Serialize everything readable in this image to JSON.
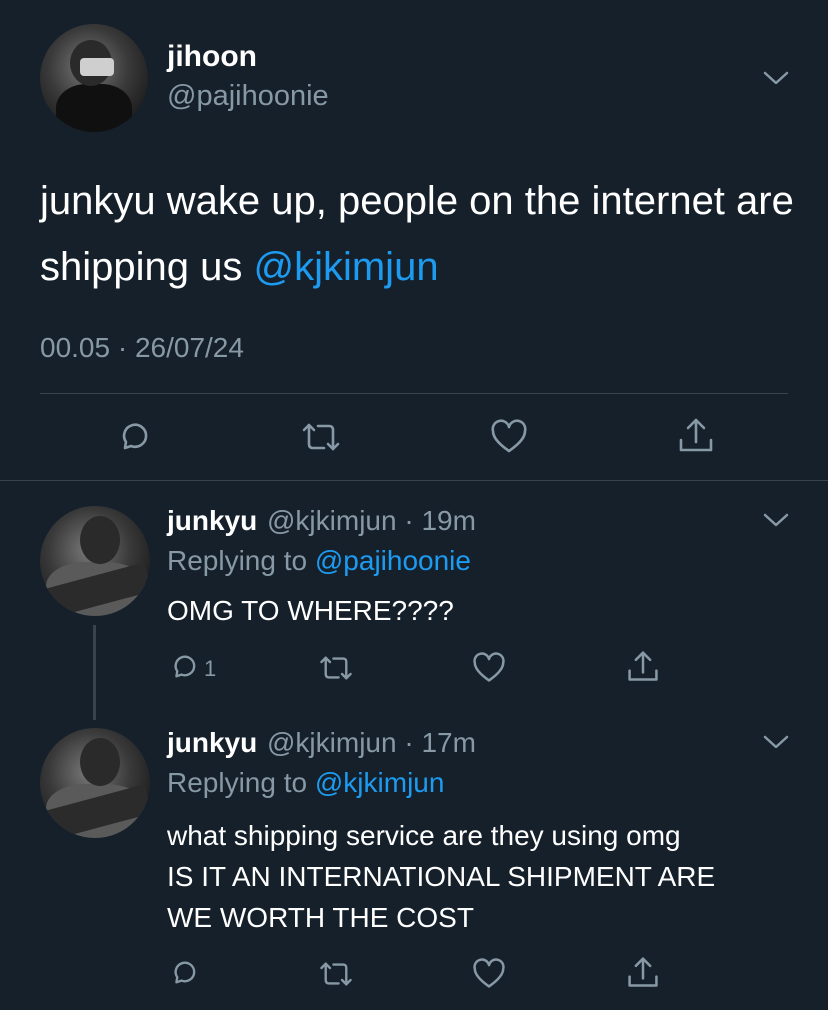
{
  "main_tweet": {
    "name": "jihoon",
    "handle": "@pajihoonie",
    "text_before": "junkyu wake up, people on the internet are shipping us ",
    "mention": "@kjkimjun",
    "timestamp": "00.05 · 26/07/24"
  },
  "replies": [
    {
      "name": "junkyu",
      "meta": "@kjkimjun · 19m",
      "replying_prefix": "Replying to ",
      "replying_to": "@pajihoonie",
      "lines": [
        "OMG TO WHERE????"
      ],
      "reply_count": "1"
    },
    {
      "name": "junkyu",
      "meta": "@kjkimjun · 17m",
      "replying_prefix": "Replying to ",
      "replying_to": "@kjkimjun",
      "lines": [
        "what shipping service are they using omg",
        "IS IT AN INTERNATIONAL SHIPMENT ARE",
        "WE WORTH THE COST"
      ],
      "reply_count": ""
    }
  ],
  "colors": {
    "background": "#15202b",
    "accent": "#1d9bf0",
    "secondary_text": "#8899a6",
    "divider": "#38444d"
  },
  "icons": [
    "reply-icon",
    "retweet-icon",
    "like-icon",
    "share-icon",
    "chevron-down-icon"
  ]
}
